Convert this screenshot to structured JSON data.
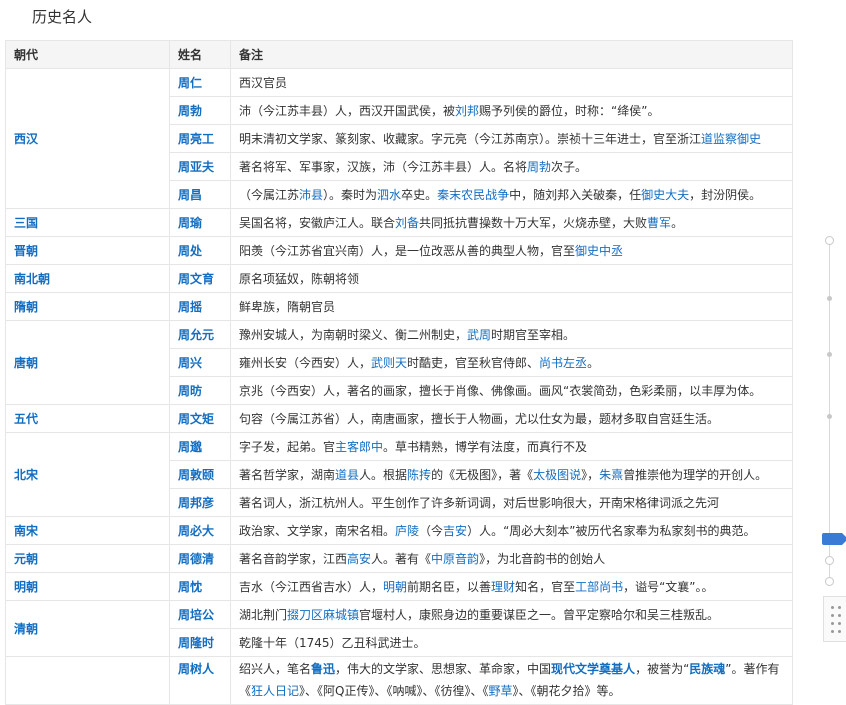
{
  "page": {
    "section_title": "历史名人"
  },
  "table": {
    "headers": {
      "dynasty": "朝代",
      "name": "姓名",
      "note": "备注"
    },
    "groups": [
      {
        "dynasty": "西汉",
        "rows": [
          {
            "name": "周仁",
            "parts": [
              {
                "t": "西汉官员"
              }
            ]
          },
          {
            "name": "周勃",
            "parts": [
              {
                "t": "沛（今江苏丰县）人，西汉开国武侯，被"
              },
              {
                "t": "刘邦",
                "link": true
              },
              {
                "t": "赐予列侯的爵位，时称：“绛侯”。"
              }
            ]
          },
          {
            "name": "周亮工",
            "parts": [
              {
                "t": "明末清初文学家、篆刻家、收藏家。字元亮（今江苏南京）。崇祯十三年进士，官至浙江"
              },
              {
                "t": "道监察御史",
                "link": true
              }
            ]
          },
          {
            "name": "周亚夫",
            "parts": [
              {
                "t": "著名将军、军事家，汉族，沛（今江苏丰县）人。名将"
              },
              {
                "t": "周勃",
                "link": true
              },
              {
                "t": "次子。"
              }
            ]
          },
          {
            "name": "周昌",
            "parts": [
              {
                "t": "（今属江苏"
              },
              {
                "t": "沛县",
                "link": true
              },
              {
                "t": "）。秦时为"
              },
              {
                "t": "泗水",
                "link": true
              },
              {
                "t": "卒史。"
              },
              {
                "t": "秦末农民战争",
                "link": true
              },
              {
                "t": "中，随刘邦入关破秦，任"
              },
              {
                "t": "御史大夫",
                "link": true
              },
              {
                "t": "，封汾阴侯。"
              }
            ]
          }
        ]
      },
      {
        "dynasty": "三国",
        "rows": [
          {
            "name": "周瑜",
            "parts": [
              {
                "t": "吴国名将，安徽庐江人。联合"
              },
              {
                "t": "刘备",
                "link": true
              },
              {
                "t": "共同抵抗曹操数十万大军，火烧赤壁，大败"
              },
              {
                "t": "曹军",
                "link": true
              },
              {
                "t": "。"
              }
            ]
          }
        ]
      },
      {
        "dynasty": "晋朝",
        "rows": [
          {
            "name": "周处",
            "parts": [
              {
                "t": "阳羡（今江苏省宜兴南）人，是一位改恶从善的典型人物，官至"
              },
              {
                "t": "御史中丞",
                "link": true
              }
            ]
          }
        ]
      },
      {
        "dynasty": "南北朝",
        "rows": [
          {
            "name": "周文育",
            "parts": [
              {
                "t": "原名项猛奴，陈朝将领"
              }
            ]
          }
        ]
      },
      {
        "dynasty": "隋朝",
        "rows": [
          {
            "name": "周摇",
            "parts": [
              {
                "t": "鲜卑族，隋朝官员"
              }
            ]
          }
        ]
      },
      {
        "dynasty": "唐朝",
        "rows": [
          {
            "name": "周允元",
            "parts": [
              {
                "t": "豫州安城人，为南朝时梁义、衡二州制史，"
              },
              {
                "t": "武周",
                "link": true
              },
              {
                "t": "时期官至宰相。"
              }
            ]
          },
          {
            "name": "周兴",
            "parts": [
              {
                "t": "雍州长安（今西安）人，"
              },
              {
                "t": "武则天",
                "link": true
              },
              {
                "t": "时酷吏，官至秋官侍郎、"
              },
              {
                "t": "尚书左丞",
                "link": true
              },
              {
                "t": "。"
              }
            ]
          },
          {
            "name": "周昉",
            "parts": [
              {
                "t": "京兆（今西安）人，著名的画家，擅长于肖像、佛像画。画风“衣裳简劲，色彩柔丽，以丰厚为体。"
              }
            ]
          }
        ]
      },
      {
        "dynasty": "五代",
        "rows": [
          {
            "name": "周文矩",
            "parts": [
              {
                "t": "句容（今属江苏省）人，南唐画家，擅长于人物画，尤以仕女为最，题材多取自宫廷生活。"
              }
            ]
          }
        ]
      },
      {
        "dynasty": "北宋",
        "rows": [
          {
            "name": "周邈",
            "parts": [
              {
                "t": "字子发，起弟。官"
              },
              {
                "t": "主客郎中",
                "link": true
              },
              {
                "t": "。草书精熟，博学有法度，而真行不及"
              }
            ]
          },
          {
            "name": "周敦颐",
            "parts": [
              {
                "t": "著名哲学家，湖南"
              },
              {
                "t": "道县",
                "link": true
              },
              {
                "t": "人。根据"
              },
              {
                "t": "陈抟",
                "link": true
              },
              {
                "t": "的《无极图》，著《"
              },
              {
                "t": "太极图说",
                "link": true
              },
              {
                "t": "》，"
              },
              {
                "t": "朱熹",
                "link": true
              },
              {
                "t": "曾推崇他为理学的开创人。"
              }
            ]
          },
          {
            "name": "周邦彦",
            "parts": [
              {
                "t": "著名词人，浙江杭州人。平生创作了许多新词调，对后世影响很大，开南宋格律词派之先河"
              }
            ]
          }
        ]
      },
      {
        "dynasty": "南宋",
        "rows": [
          {
            "name": "周必大",
            "parts": [
              {
                "t": "政治家、文学家，南宋名相。"
              },
              {
                "t": "庐陵",
                "link": true
              },
              {
                "t": "（今"
              },
              {
                "t": "吉安",
                "link": true
              },
              {
                "t": "）人。“周必大刻本”被历代名家奉为私家刻书的典范。"
              }
            ]
          }
        ]
      },
      {
        "dynasty": "元朝",
        "rows": [
          {
            "name": "周德清",
            "parts": [
              {
                "t": "著名音韵学家，江西"
              },
              {
                "t": "高安",
                "link": true
              },
              {
                "t": "人。著有《"
              },
              {
                "t": "中原音韵",
                "link": true
              },
              {
                "t": "》，为北音韵书的创始人"
              }
            ]
          }
        ]
      },
      {
        "dynasty": "明朝",
        "rows": [
          {
            "name": "周忱",
            "parts": [
              {
                "t": "吉水（今江西省吉水）人，"
              },
              {
                "t": "明朝",
                "link": true
              },
              {
                "t": "前期名臣，以善"
              },
              {
                "t": "理财",
                "link": true
              },
              {
                "t": "知名，官至"
              },
              {
                "t": "工部尚书",
                "link": true
              },
              {
                "t": "，谥号“文襄”。。"
              }
            ]
          }
        ]
      },
      {
        "dynasty": "清朝",
        "rows": [
          {
            "name": "周培公",
            "parts": [
              {
                "t": "湖北荆门"
              },
              {
                "t": "掇刀区麻城镇",
                "link": true
              },
              {
                "t": "官堰村人，康熙身边的重要谋臣之一。曾平定察哈尔和吴三桂叛乱。"
              }
            ]
          },
          {
            "name": "周隆时",
            "parts": [
              {
                "t": "乾隆十年（1745）乙丑科武进士。"
              }
            ]
          }
        ]
      },
      {
        "dynasty": "",
        "rows": [
          {
            "name": "周树人",
            "tall": true,
            "parts": [
              {
                "t": "绍兴人，笔名"
              },
              {
                "t": "鲁迅",
                "link": true,
                "bold": true
              },
              {
                "t": "，伟大的文学家、思想家、革命家，中国"
              },
              {
                "t": "现代文学奠基人",
                "link": true,
                "bold": true
              },
              {
                "t": "，被誉为“"
              },
              {
                "t": "民族魂",
                "link": true,
                "bold": true
              },
              {
                "t": "”。著作有《"
              },
              {
                "t": "狂人日记",
                "link": true
              },
              {
                "t": "》、《阿Q正传》、《呐喊》、《彷徨》、《"
              },
              {
                "t": "野草",
                "link": true
              },
              {
                "t": "》、《朝花夕拾》等。"
              }
            ]
          }
        ]
      }
    ]
  },
  "side_widget": {
    "active_color": "#3a7bd5",
    "grid_icon": "grid-icon"
  }
}
